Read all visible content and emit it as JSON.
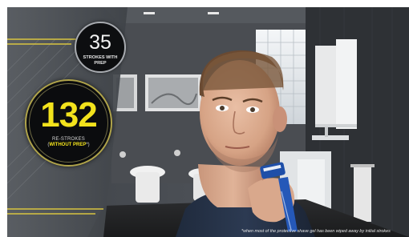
{
  "stats": {
    "with_prep": {
      "value": "35",
      "label_prefix": "STROKES ",
      "label_bold": "WITH",
      "label_line2": "PREP"
    },
    "without_prep": {
      "value": "132",
      "label_line1": "RE-STROKES",
      "label_open": "(",
      "label_highlight": "WITHOUT PREP",
      "label_close": "*)"
    }
  },
  "footnote": {
    "text": "*when most of the protective shave gel has been wiped away by initial strokes"
  },
  "colors": {
    "highlight_yellow": "#f2e21c",
    "badge_dark": "#0b0c0e",
    "bathroom_wall": "#3a3d42"
  },
  "scene": {
    "subject": "man shaving neck with blue razor in a dark bathroom"
  }
}
